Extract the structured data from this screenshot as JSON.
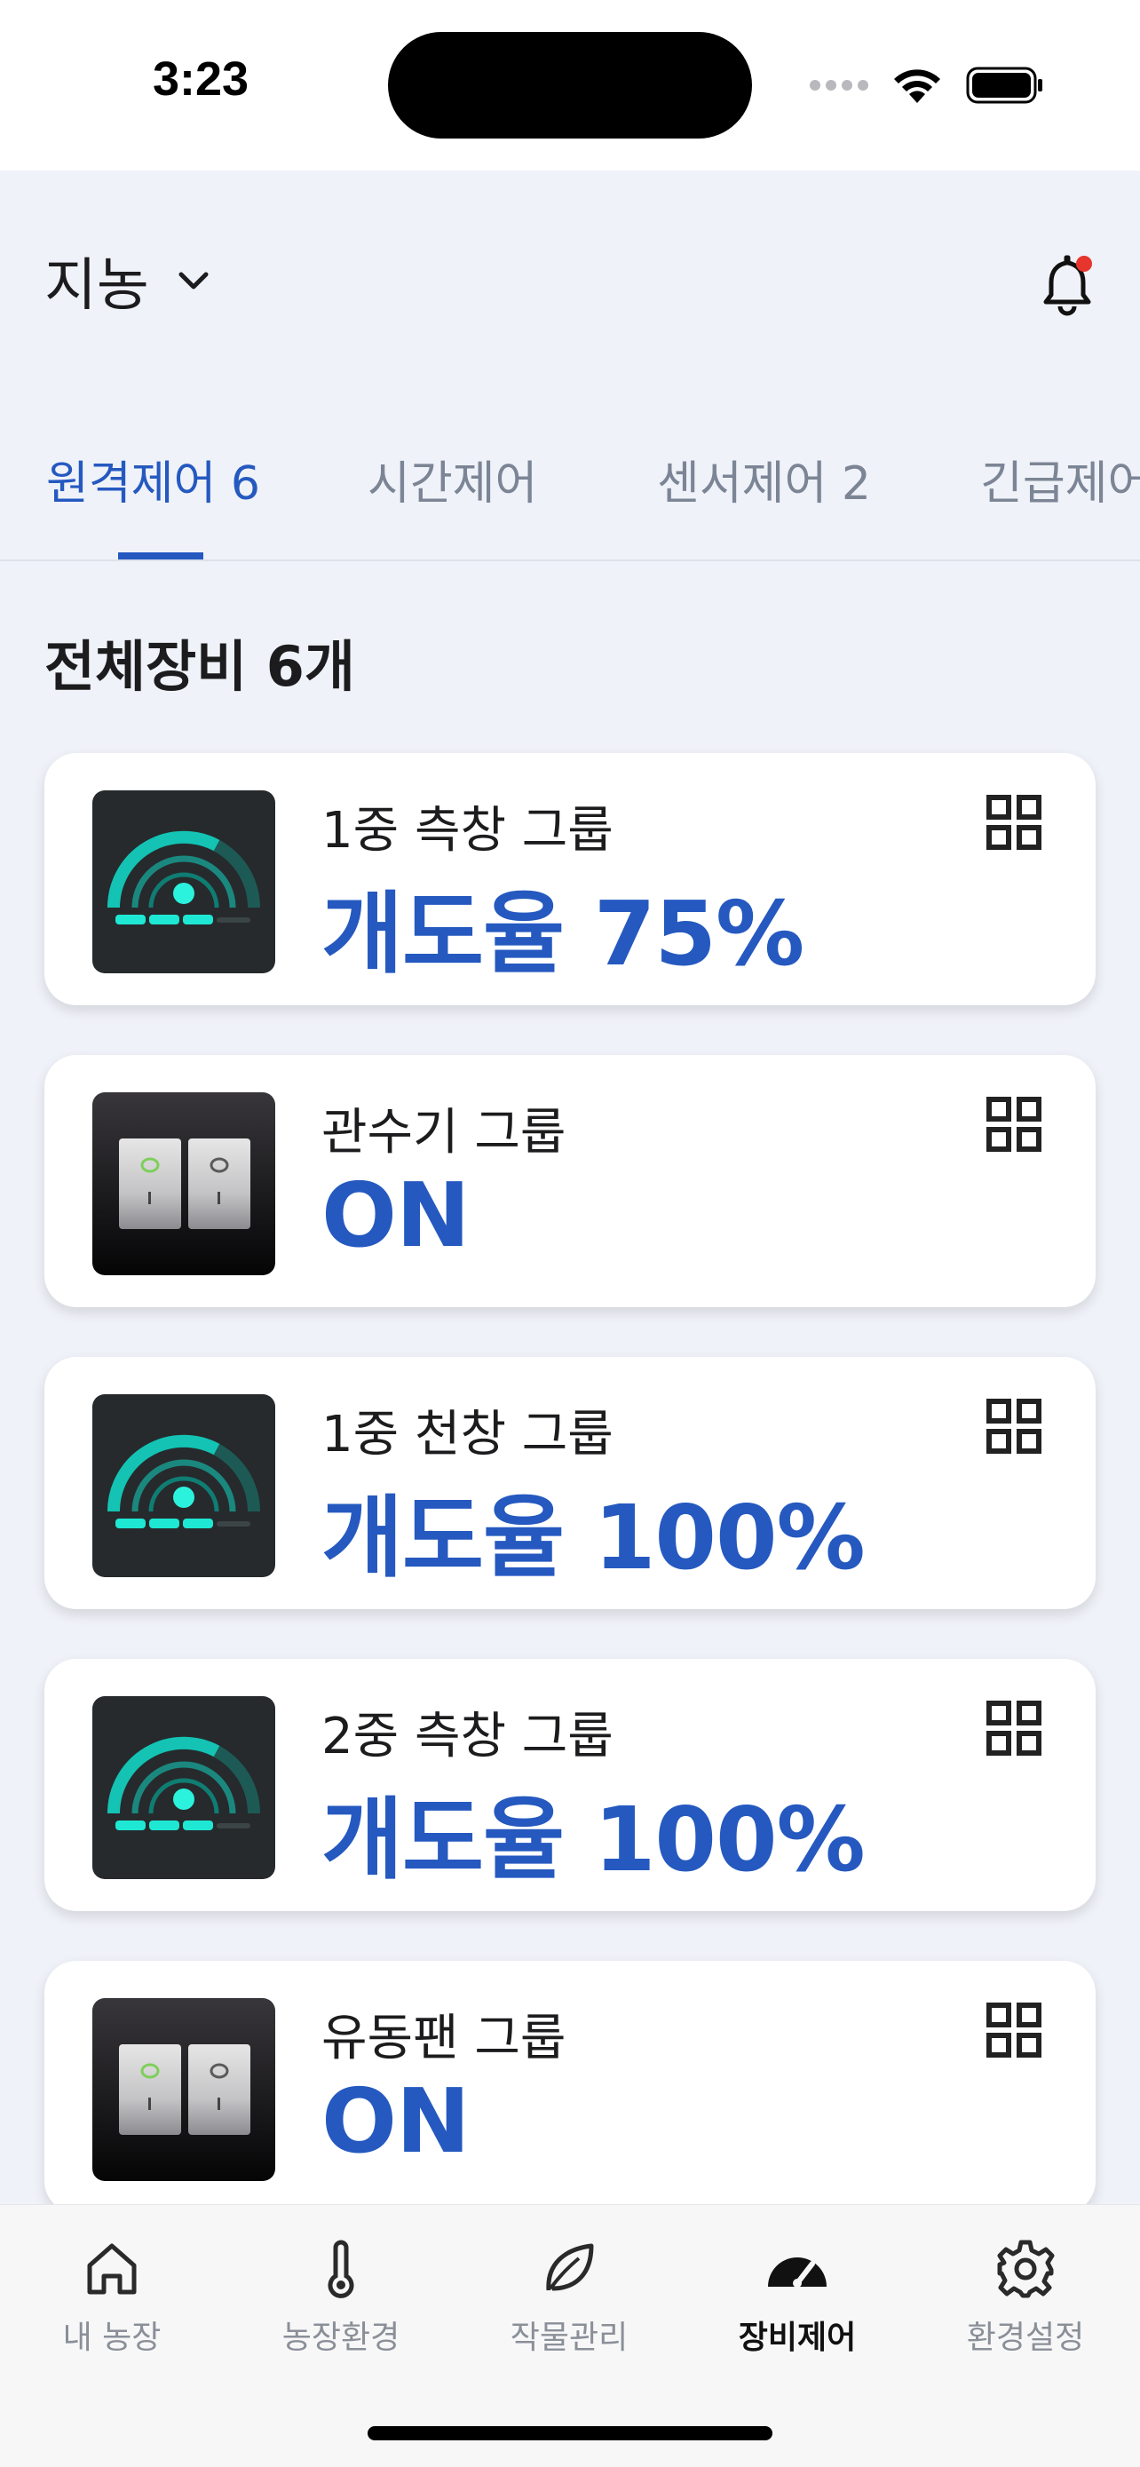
{
  "status_bar": {
    "time": "3:23"
  },
  "header": {
    "farm_name": "지농"
  },
  "tabs": [
    {
      "label": "원격제어 6",
      "active": true
    },
    {
      "label": "시간제어",
      "active": false
    },
    {
      "label": "센서제어 2",
      "active": false
    },
    {
      "label": "긴급제어",
      "active": false
    }
  ],
  "section": {
    "title": "전체장비 6개"
  },
  "devices": [
    {
      "name": "1중 측창 그룹",
      "value": "개도율 75%",
      "thumb": "gauge-icon"
    },
    {
      "name": "관수기 그룹",
      "value": "ON",
      "thumb": "switch-icon"
    },
    {
      "name": "1중 천창 그룹",
      "value": "개도율 100%",
      "thumb": "gauge-icon"
    },
    {
      "name": "2중 측창 그룹",
      "value": "개도율 100%",
      "thumb": "gauge-icon"
    },
    {
      "name": "유동팬 그룹",
      "value": "ON",
      "thumb": "switch-icon"
    }
  ],
  "bottom_nav": [
    {
      "label": "내 농장",
      "icon": "home-icon",
      "active": false
    },
    {
      "label": "농장환경",
      "icon": "thermometer-icon",
      "active": false
    },
    {
      "label": "작물관리",
      "icon": "leaf-icon",
      "active": false
    },
    {
      "label": "장비제어",
      "icon": "gauge-icon",
      "active": true
    },
    {
      "label": "환경설정",
      "icon": "gear-icon",
      "active": false
    }
  ],
  "colors": {
    "accent": "#2559c0",
    "background": "#eff2f8",
    "notification_dot": "#e5352d"
  }
}
